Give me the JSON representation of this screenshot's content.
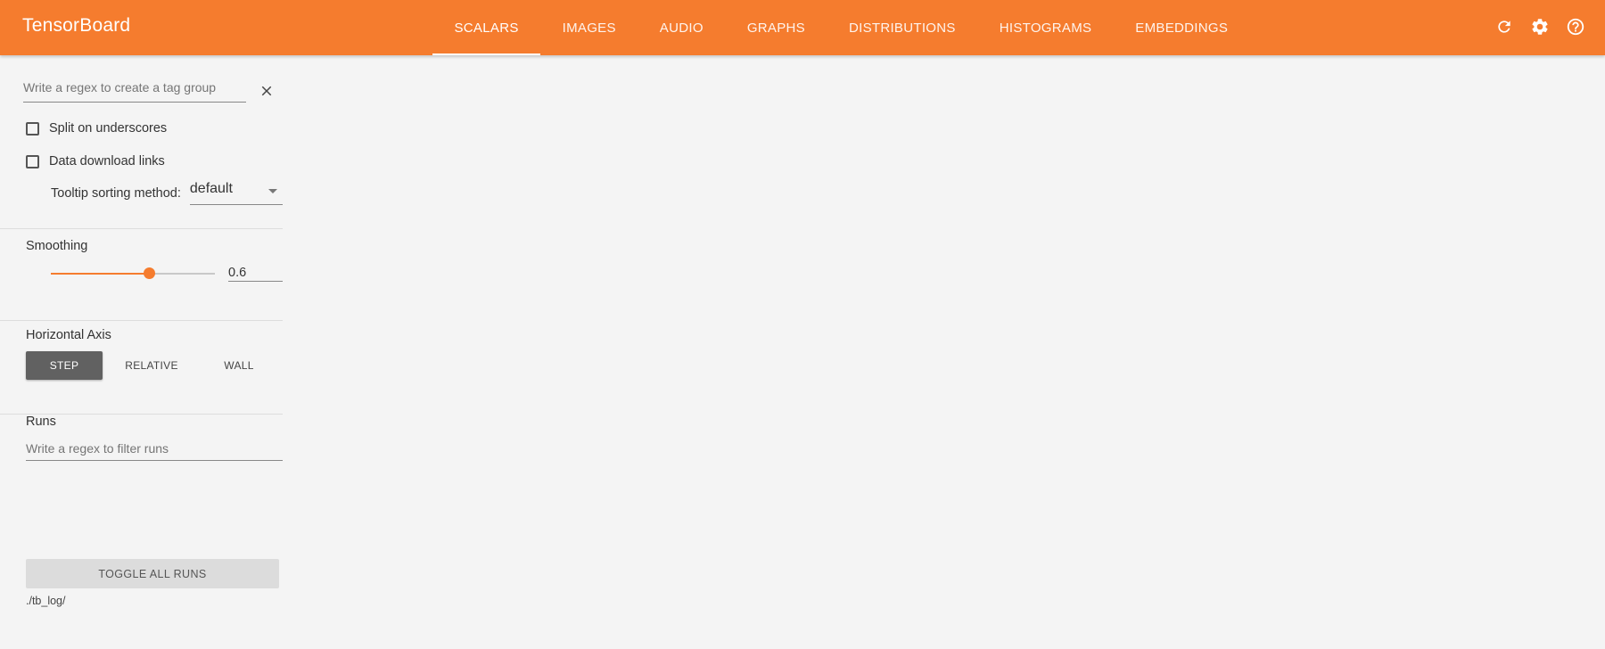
{
  "app": {
    "title": "TensorBoard"
  },
  "nav": {
    "tabs": [
      {
        "label": "SCALARS",
        "active": true
      },
      {
        "label": "IMAGES"
      },
      {
        "label": "AUDIO"
      },
      {
        "label": "GRAPHS"
      },
      {
        "label": "DISTRIBUTIONS"
      },
      {
        "label": "HISTOGRAMS"
      },
      {
        "label": "EMBEDDINGS"
      }
    ],
    "icons": [
      "refresh-icon",
      "settings-icon",
      "help-icon"
    ]
  },
  "sidebar": {
    "tag_regex": {
      "placeholder": "Write a regex to create a tag group",
      "value": ""
    },
    "split_underscores": {
      "label": "Split on underscores",
      "checked": false
    },
    "data_download": {
      "label": "Data download links",
      "checked": false
    },
    "tooltip_sort": {
      "label": "Tooltip sorting method:",
      "value": "default"
    },
    "smoothing": {
      "title": "Smoothing",
      "value": "0.6",
      "level": 0.6
    },
    "horizontal_axis": {
      "title": "Horizontal Axis",
      "options": [
        {
          "label": "STEP",
          "active": true
        },
        {
          "label": "RELATIVE"
        },
        {
          "label": "WALL"
        }
      ]
    },
    "runs": {
      "title": "Runs",
      "placeholder": "Write a regex to filter runs",
      "toggle_label": "TOGGLE ALL RUNS",
      "logdir": "./tb_log/"
    }
  },
  "colors": {
    "accent": "#f57c2e",
    "active_button": "#616161",
    "background": "#f4f4f4"
  }
}
